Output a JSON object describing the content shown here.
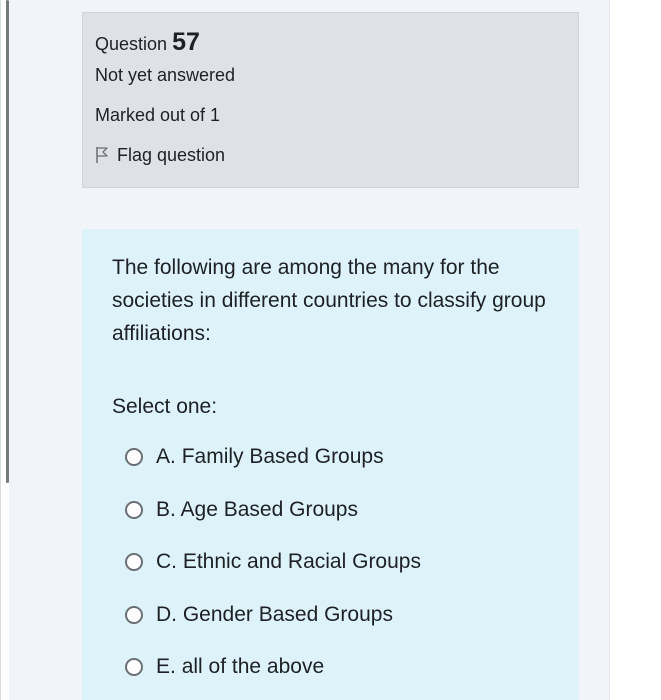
{
  "question": {
    "prefix": "Question",
    "number": "57",
    "state": "Not yet answered",
    "grade": "Marked out of 1",
    "flag_label": "Flag question"
  },
  "formulation": {
    "text": "The following are among the many for the societies in different countries to classify group affiliations:",
    "prompt": "Select one:",
    "answers": [
      {
        "letter": "A.",
        "text": "Family Based Groups"
      },
      {
        "letter": "B.",
        "text": "Age Based Groups"
      },
      {
        "letter": "C.",
        "text": "Ethnic and Racial Groups"
      },
      {
        "letter": "D.",
        "text": "Gender Based Groups"
      },
      {
        "letter": "E.",
        "text": "all of the above"
      }
    ]
  },
  "colors": {
    "info_bg": "#dee2e6",
    "formulation_bg": "#def2f9",
    "page_bg": "#f1f4f8"
  }
}
